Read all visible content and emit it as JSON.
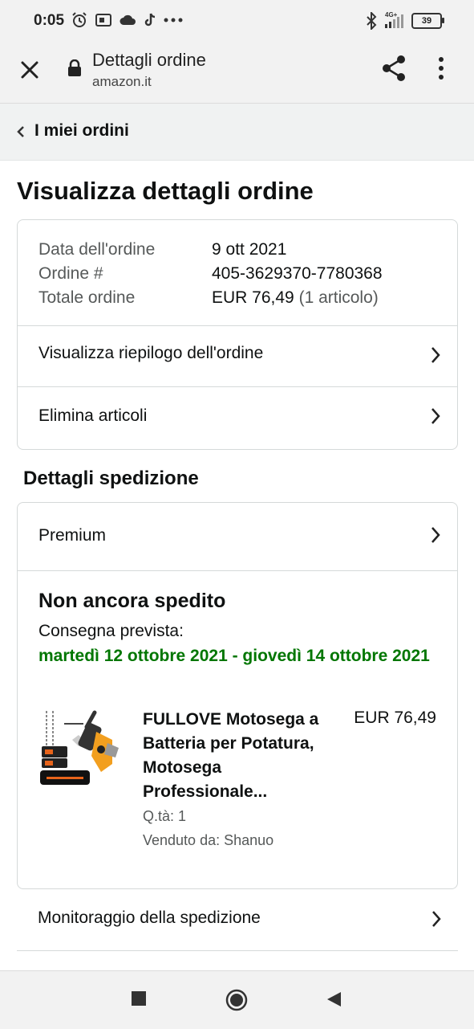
{
  "status_bar": {
    "time": "0:05",
    "network": "4G+",
    "battery": "39"
  },
  "browser": {
    "title": "Dettagli ordine",
    "url": "amazon.it"
  },
  "breadcrumb": {
    "label": "I miei ordini"
  },
  "page": {
    "title": "Visualizza dettagli ordine"
  },
  "order_summary": {
    "date_label": "Data dell'ordine",
    "date_value": "9 ott 2021",
    "order_label": "Ordine #",
    "order_value": "405-3629370-7780368",
    "total_label": "Totale ordine",
    "total_value": "EUR 76,49",
    "total_items": "(1 articolo)"
  },
  "actions": {
    "view_summary": "Visualizza riepilogo dell'ordine",
    "delete_items": "Elimina articoli"
  },
  "shipping": {
    "section_title": "Dettagli spedizione",
    "speed": "Premium",
    "status": "Non ancora spedito",
    "delivery_label": "Consegna prevista:",
    "delivery_range": "martedì 12 ottobre 2021 - giovedì 14 ottobre 2021",
    "track_label": "Monitoraggio della spedizione"
  },
  "product": {
    "name": "FULLOVE Motosega a Batteria per Potatura, Motosega Professionale...",
    "price": "EUR 76,49",
    "quantity": "Q.tà: 1",
    "seller": "Venduto da: Shanuo"
  },
  "colors": {
    "accent_green": "#007600",
    "text": "#0f1111",
    "muted": "#565959",
    "border": "#d5d9d9"
  }
}
